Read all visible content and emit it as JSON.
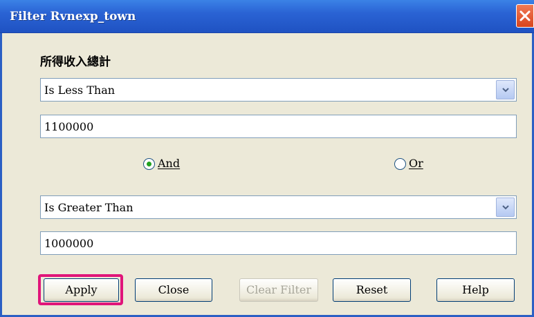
{
  "window": {
    "title": "Filter Rvnexp_town"
  },
  "field": {
    "label": "所得收入總計"
  },
  "condition1": {
    "operator": "Is Less Than",
    "value": "1100000"
  },
  "logic": {
    "and_label": "And",
    "or_label": "Or",
    "selected": "And"
  },
  "condition2": {
    "operator": "Is Greater Than",
    "value": "1000000"
  },
  "buttons": {
    "apply": "Apply",
    "close": "Close",
    "clear_filter": "Clear Filter",
    "reset": "Reset",
    "help": "Help"
  },
  "colors": {
    "highlight": "#e0157a",
    "titlebar": "#2a63d4"
  }
}
